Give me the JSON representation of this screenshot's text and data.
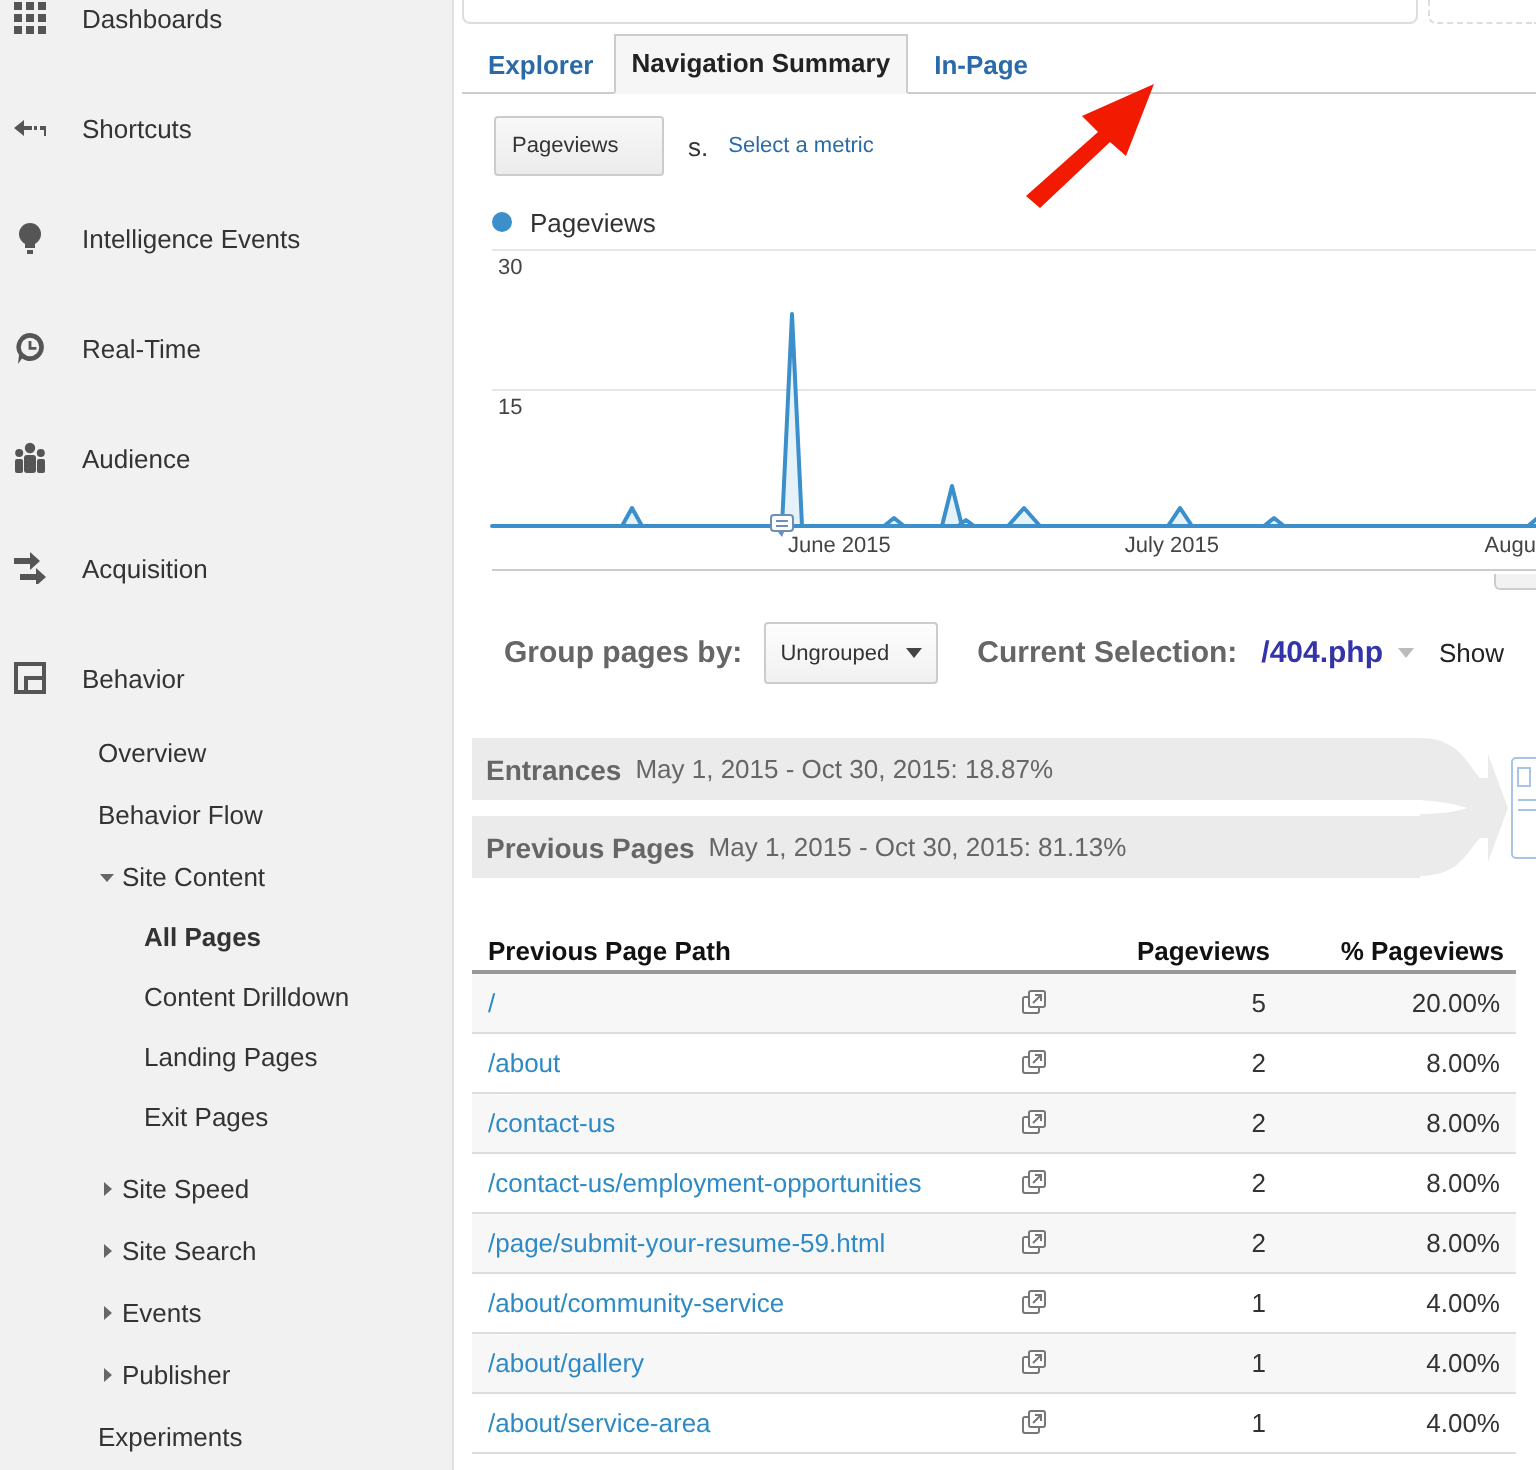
{
  "sidebar": {
    "items": [
      {
        "label": "Dashboards",
        "selected": false
      },
      {
        "label": "Shortcuts",
        "selected": false
      },
      {
        "label": "Intelligence Events",
        "selected": false
      },
      {
        "label": "Real-Time",
        "selected": false
      },
      {
        "label": "Audience",
        "selected": false
      },
      {
        "label": "Acquisition",
        "selected": false
      },
      {
        "label": "Behavior",
        "selected": false,
        "children": [
          {
            "label": "Overview",
            "selected": false
          },
          {
            "label": "Behavior Flow",
            "selected": false
          },
          {
            "label": "Site Content",
            "selected": false,
            "expanded": true,
            "children": [
              {
                "label": "All Pages",
                "selected": true
              },
              {
                "label": "Content Drilldown",
                "selected": false
              },
              {
                "label": "Landing Pages",
                "selected": false
              },
              {
                "label": "Exit Pages",
                "selected": false
              }
            ]
          },
          {
            "label": "Site Speed",
            "selected": false,
            "expanded": false
          },
          {
            "label": "Site Search",
            "selected": false,
            "expanded": false
          },
          {
            "label": "Events",
            "selected": false,
            "expanded": false
          },
          {
            "label": "Publisher",
            "selected": false,
            "expanded": false
          },
          {
            "label": "Experiments",
            "selected": false
          }
        ]
      }
    ]
  },
  "tabs": [
    {
      "label": "Explorer",
      "selected": false
    },
    {
      "label": "Navigation Summary",
      "selected": true
    },
    {
      "label": "In-Page",
      "selected": false
    }
  ],
  "metric": {
    "button": "Pageviews",
    "versus": "s.",
    "select_link": "Select a metric"
  },
  "chart": {
    "legend": "Pageviews",
    "y_axis_labels": [
      "30",
      "15"
    ],
    "x_axis_labels": [
      "June 2015",
      "July 2015",
      "Augu"
    ]
  },
  "grouping": {
    "label": "Group pages by:",
    "dropdown": "Ungrouped",
    "selection_label": "Current Selection:",
    "selection_value": "/404.php",
    "show_label": "Show"
  },
  "flow": [
    {
      "title": "Entrances",
      "detail": "May 1, 2015 - Oct 30, 2015: 18.87%"
    },
    {
      "title": "Previous Pages",
      "detail": "May 1, 2015 - Oct 30, 2015: 81.13%"
    }
  ],
  "table": {
    "columns": [
      "Previous Page Path",
      "Pageviews",
      "% Pageviews"
    ],
    "rows": [
      {
        "path": "/",
        "pageviews": "5",
        "percent": "20.00%"
      },
      {
        "path": "/about",
        "pageviews": "2",
        "percent": "8.00%"
      },
      {
        "path": "/contact-us",
        "pageviews": "2",
        "percent": "8.00%"
      },
      {
        "path": "/contact-us/employment-opportunities",
        "pageviews": "2",
        "percent": "8.00%"
      },
      {
        "path": "/page/submit-your-resume-59.html",
        "pageviews": "2",
        "percent": "8.00%"
      },
      {
        "path": "/about/community-service",
        "pageviews": "1",
        "percent": "4.00%"
      },
      {
        "path": "/about/gallery",
        "pageviews": "1",
        "percent": "4.00%"
      },
      {
        "path": "/about/service-area",
        "pageviews": "1",
        "percent": "4.00%"
      }
    ]
  }
}
